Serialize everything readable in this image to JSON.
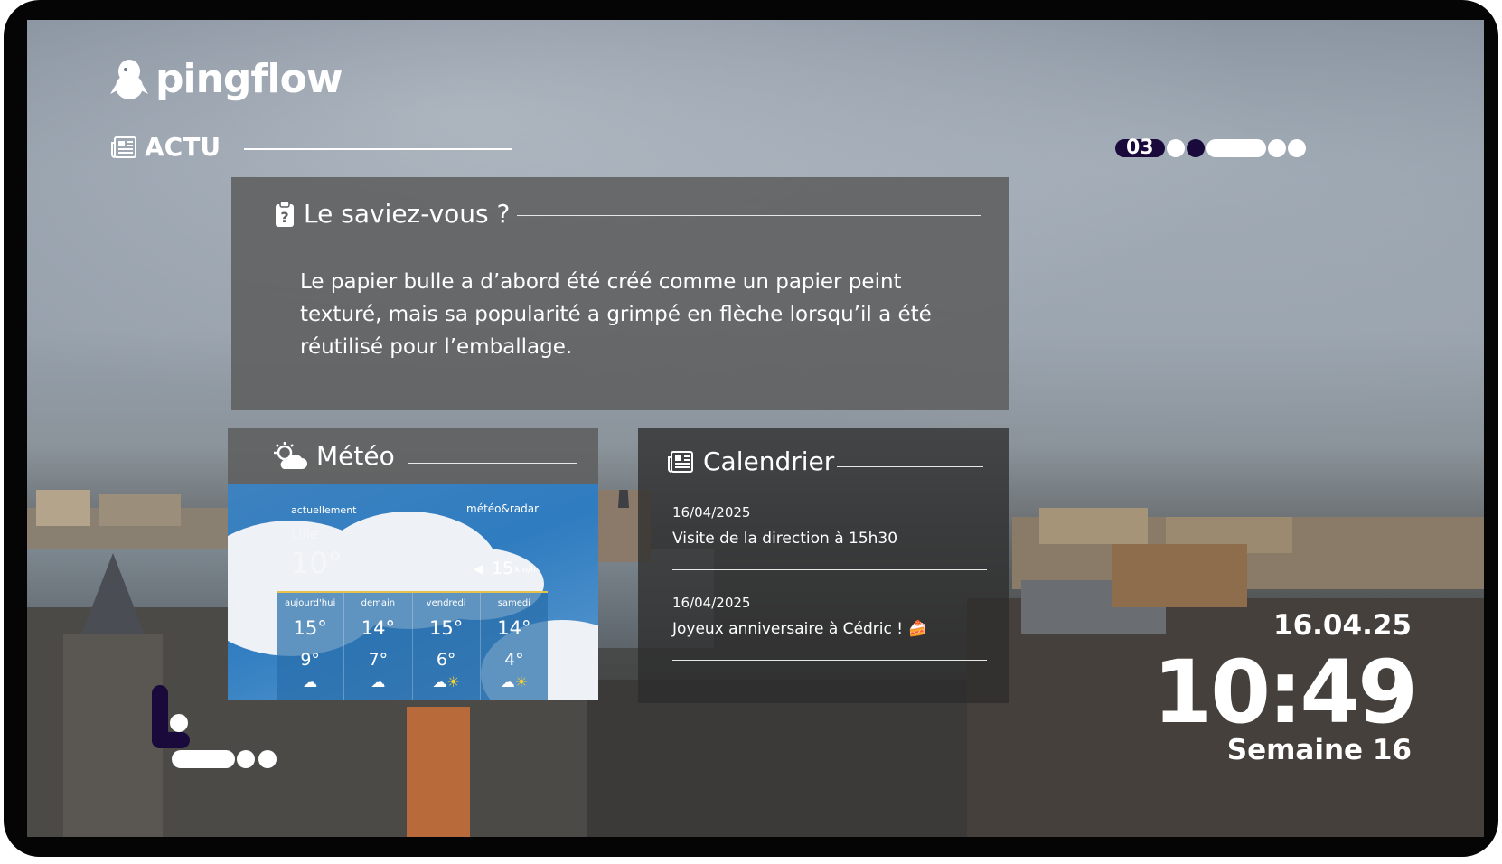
{
  "brand": {
    "name": "pingflow"
  },
  "section": {
    "label": "ACTU"
  },
  "pager": {
    "current": "03"
  },
  "fact_card": {
    "title": "Le saviez-vous ?",
    "text": "Le papier bulle a d’abord été créé comme un papier peint texturé, mais sa popularité a grimpé en flèche lorsqu’il a été réutilisé pour l’emballage."
  },
  "meteo": {
    "title": "Météo",
    "now_label": "actuellement",
    "provider": "météo&radar",
    "city": "Lille",
    "temp": "10°",
    "wind": "15",
    "wind_unit": "km/h",
    "forecast": [
      {
        "day": "aujourd'hui",
        "high": "15°",
        "low": "9°",
        "icon": "cloud-icon"
      },
      {
        "day": "demain",
        "high": "14°",
        "low": "7°",
        "icon": "cloud-icon"
      },
      {
        "day": "vendredi",
        "high": "15°",
        "low": "6°",
        "icon": "sun-cloud-icon"
      },
      {
        "day": "samedi",
        "high": "14°",
        "low": "4°",
        "icon": "sun-cloud-icon"
      }
    ]
  },
  "calendar": {
    "title": "Calendrier",
    "events": [
      {
        "date": "16/04/2025",
        "title": "Visite de la direction à 15h30"
      },
      {
        "date": "16/04/2025",
        "title": "Joyeux anniversaire à Cédric ! 🍰"
      }
    ]
  },
  "clock": {
    "date": "16.04.25",
    "time": "10:49",
    "week": "Semaine 16"
  },
  "colors": {
    "accent": "#1a0a3c",
    "card": "#5f5f5f",
    "forecast_border": "#e6c14c"
  }
}
